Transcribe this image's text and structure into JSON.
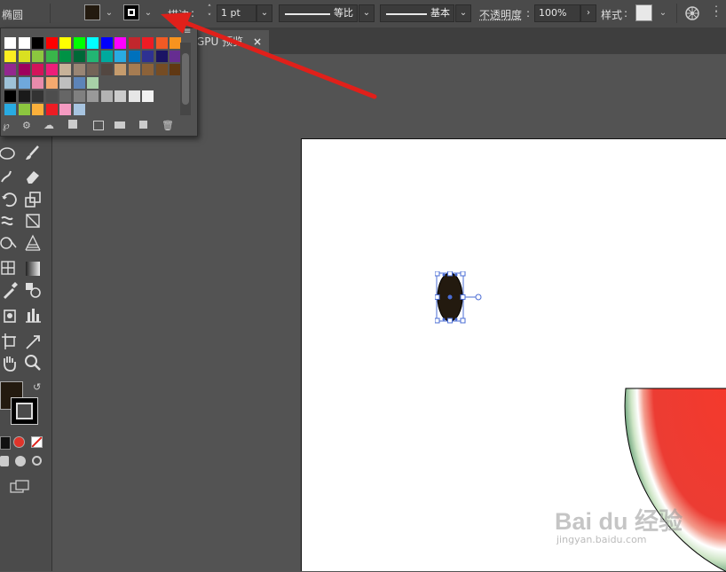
{
  "control_bar": {
    "tool_name": "椭圆",
    "stroke_label": "描边",
    "stroke_weight": "1 pt",
    "profile_label": "等比",
    "brush_label": "基本",
    "opacity_label": "不透明度",
    "opacity_value": "100%",
    "style_label": "样式",
    "fill_color": "#231a0f",
    "stroke_color": "#000000"
  },
  "document_tab": {
    "title": "GPU 预览"
  },
  "toolbar": {
    "fill_color": "#231a0f",
    "stroke_color": "#000000"
  },
  "swatch_panel": {
    "rows": [
      [
        "#ffffff",
        "#ffffff",
        "#000000",
        "#ff0000",
        "#ffff00",
        "#00ff00",
        "#00ffff",
        "#0000ff",
        "#ff00ff",
        "#c1272d",
        "#ed1c24",
        "#f15a24",
        "#f7931e"
      ],
      [
        "#fcee21",
        "#d9e021",
        "#8cc63f",
        "#39b54a",
        "#009245",
        "#006837",
        "#22b573",
        "#00a99d",
        "#29abe2",
        "#0071bc",
        "#2e3192",
        "#1b1464",
        "#662d91"
      ],
      [
        "#93278f",
        "#9e005d",
        "#d4145a",
        "#ed1e79",
        "#c7b299",
        "#998675",
        "#736357",
        "#534741",
        "#c69c6d",
        "#a67c52",
        "#8c6239",
        "#754c24",
        "#603813"
      ],
      [
        "#9ec2d8",
        "#6fa8dc",
        "#e98bab",
        "#f4a96f",
        "#bfbfbf",
        "#5d84b8",
        "#a8d1a8",
        "",
        "",
        "",
        "",
        "",
        ""
      ],
      [
        "#000000",
        "#1a1a1a",
        "#333333",
        "#4d4d4d",
        "#666666",
        "#808080",
        "#999999",
        "#b3b3b3",
        "#cccccc",
        "#e6e6e6",
        "#f2f2f2",
        "",
        ""
      ],
      [
        "#29abe2",
        "#8cc63f",
        "#fbb03b",
        "#ed1c24",
        "#f49ac1",
        "#a7c4e0",
        "",
        "",
        "",
        "",
        "",
        "",
        ""
      ]
    ]
  },
  "artboard": {
    "ellipse_fill": "#231a0f",
    "watermark_text": "Bai du 经验",
    "watermark_url": "jingyan.baidu.com"
  }
}
